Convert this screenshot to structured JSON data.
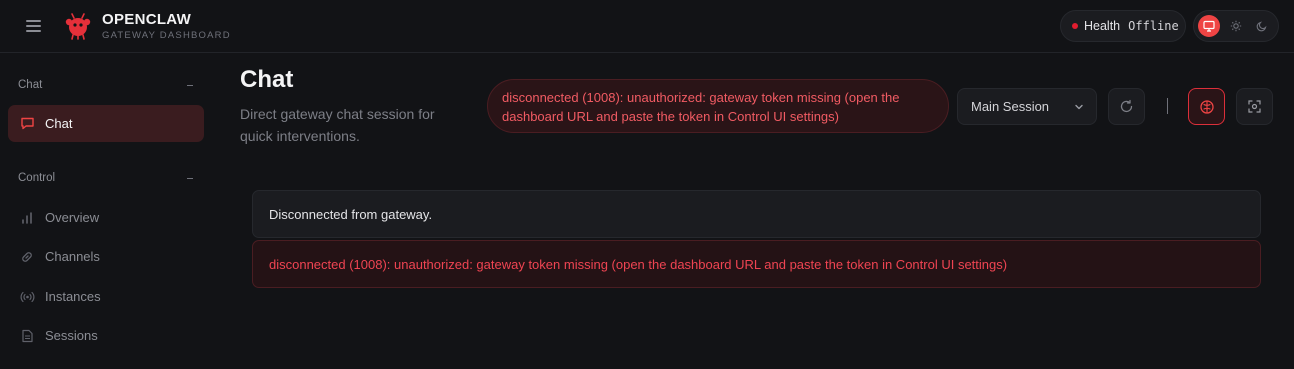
{
  "app": {
    "title": "OPENCLAW",
    "subtitle": "GATEWAY DASHBOARD"
  },
  "health": {
    "label": "Health",
    "value": "Offline",
    "status_color": "#e11d2f"
  },
  "theme": {
    "options": [
      "monitor-icon",
      "sun-icon",
      "moon-icon"
    ],
    "active": "monitor-icon",
    "accent": "#ef4444"
  },
  "sidebar": {
    "sections": [
      {
        "label": "Chat",
        "items": [
          {
            "label": "Chat",
            "icon": "chat-bubble-icon",
            "active": true
          }
        ]
      },
      {
        "label": "Control",
        "items": [
          {
            "label": "Overview",
            "icon": "bar-chart-icon",
            "active": false
          },
          {
            "label": "Channels",
            "icon": "link-icon",
            "active": false
          },
          {
            "label": "Instances",
            "icon": "broadcast-icon",
            "active": false
          },
          {
            "label": "Sessions",
            "icon": "document-icon",
            "active": false
          }
        ]
      }
    ]
  },
  "main": {
    "title": "Chat",
    "subtitle": "Direct gateway chat session for quick interventions.",
    "error_banner": "disconnected (1008): unauthorized: gateway token missing (open the dashboard URL and paste the token in Control UI settings)",
    "session_select": {
      "value": "Main Session"
    },
    "toolbar_icons": [
      "refresh-icon",
      "brain-icon",
      "focus-icon"
    ]
  },
  "chat": {
    "messages": [
      {
        "type": "info",
        "text": "Disconnected from gateway."
      },
      {
        "type": "error",
        "text": "disconnected (1008): unauthorized: gateway token missing (open the dashboard URL and paste the token in Control UI settings)"
      }
    ]
  }
}
